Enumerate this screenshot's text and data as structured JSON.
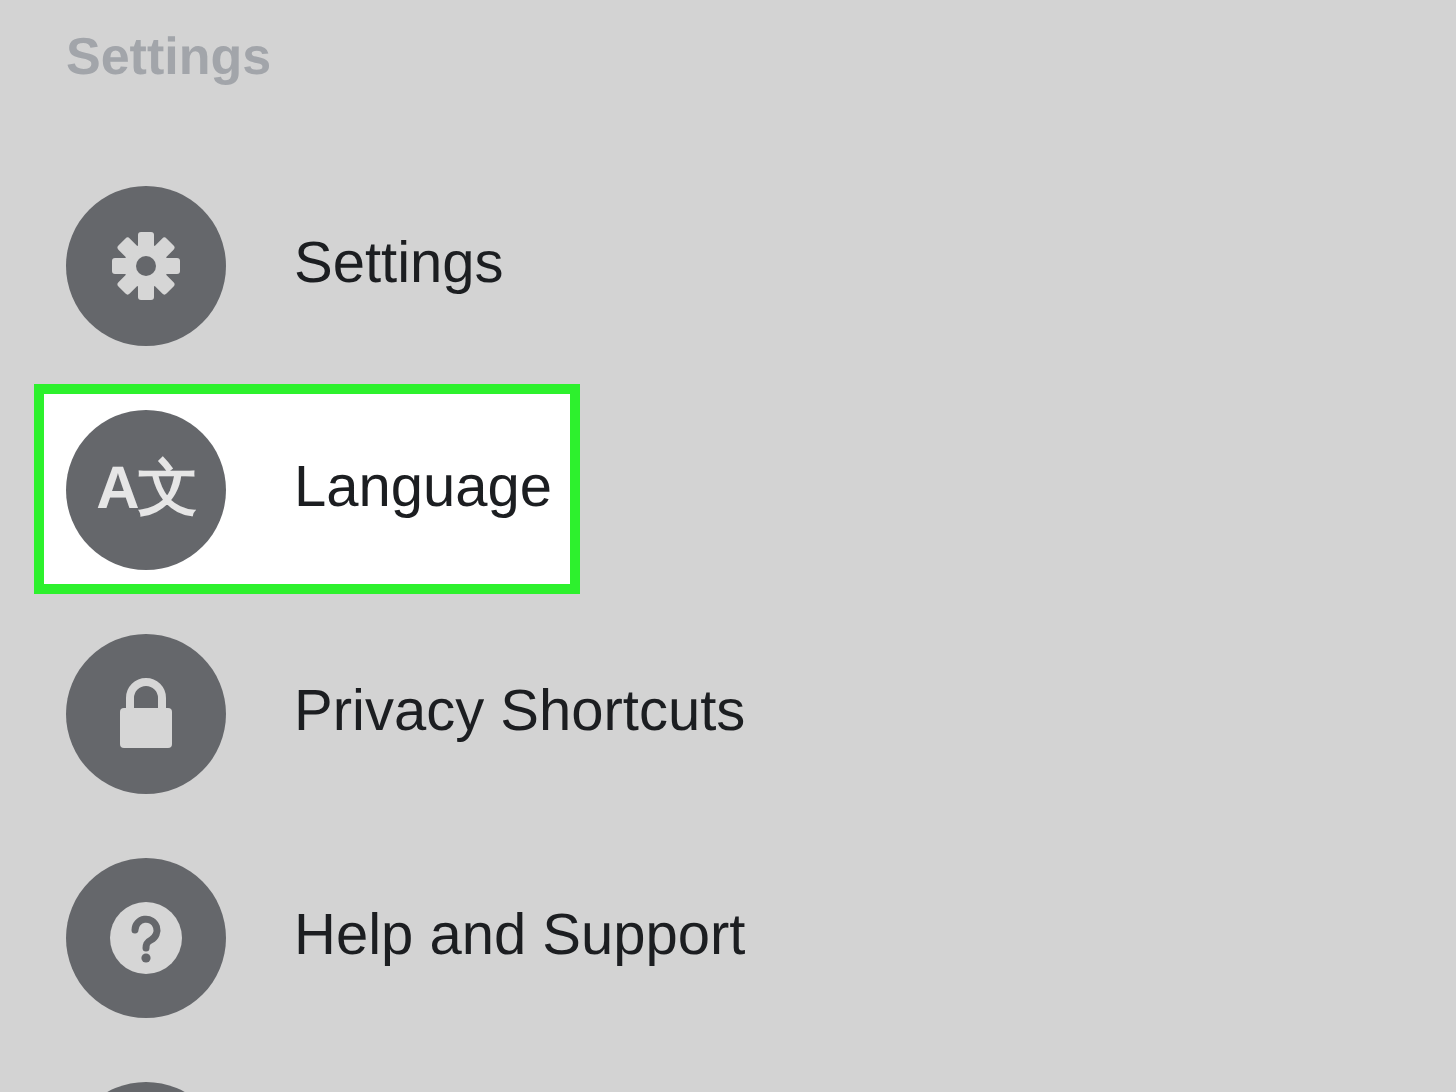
{
  "header": {
    "title": "Settings"
  },
  "items": [
    {
      "kind": "gear",
      "label": "Settings",
      "highlighted": false
    },
    {
      "kind": "translate",
      "icon_text": "A文",
      "label": "Language",
      "highlighted": true
    },
    {
      "kind": "lock",
      "label": "Privacy Shortcuts",
      "highlighted": false
    },
    {
      "kind": "question",
      "label": "Help and Support",
      "highlighted": false
    },
    {
      "kind": "blank",
      "highlighted": false
    }
  ]
}
